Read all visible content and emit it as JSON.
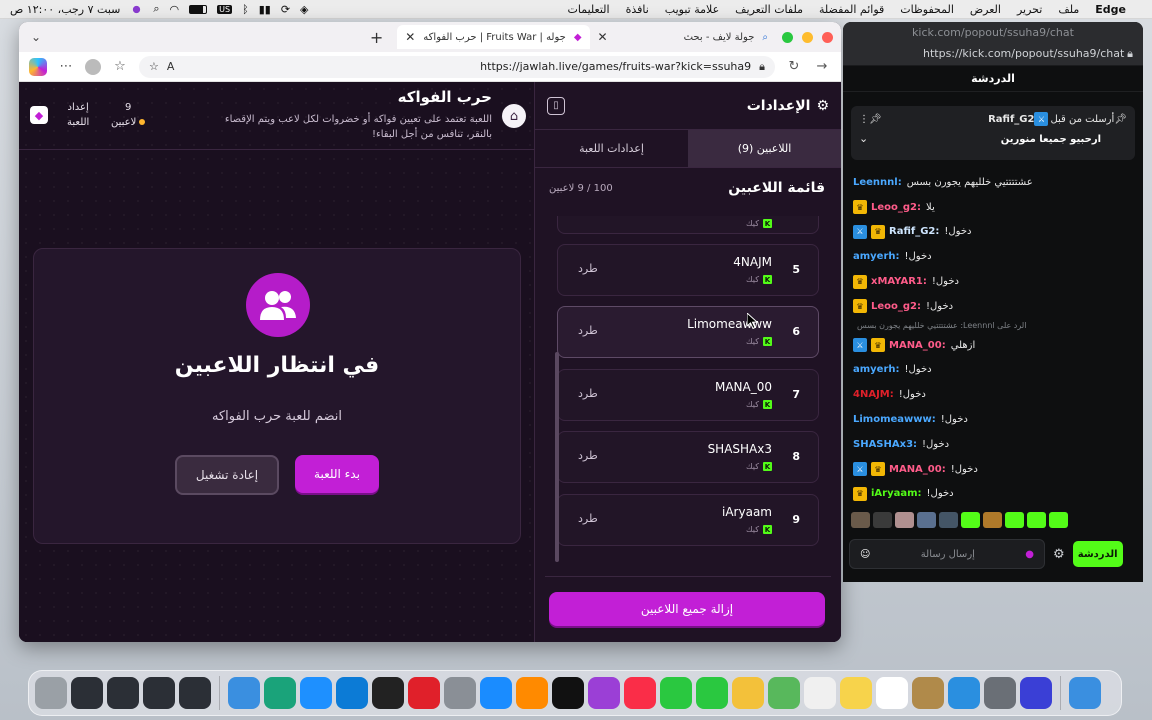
{
  "menubar": {
    "clock": "سبت ٧ رجب، ١٢:٠٠ ص",
    "input_badge": "US",
    "app_name": "Edge",
    "menus": [
      "ملف",
      "تحرير",
      "العرض",
      "المحفوظات",
      "قوائم المفضلة",
      "ملفات التعريف",
      "علامة تبويب",
      "نافذة",
      "التعليمات"
    ]
  },
  "browser": {
    "tabs": [
      {
        "label": "جولة لايف - بحث",
        "active": false
      },
      {
        "label": "حرب الفواكه | Fruits War | جوله",
        "active": true
      }
    ],
    "url": "https://jawlah.live/games/fruits-war?kick=ssuha9"
  },
  "game": {
    "title": "حرب الفواكه",
    "description": "اللعبة تعتمد على تعيين فواكه أو خضروات لكل لاعب ويتم الإقصاء بالنقر، تنافس من أجل البقاء!",
    "players_count": "9",
    "players_label": "لاعبين",
    "settings_label_1": "إعداد",
    "settings_label_2": "اللعبة",
    "waiting_title": "في انتظار اللاعبين",
    "waiting_sub": "انضم للعبة حرب الفواكه",
    "start_button": "بدء اللعبة",
    "restart_button": "إعادة تشغيل"
  },
  "settings": {
    "title": "الإعدادات",
    "tabs": [
      {
        "label": "اللاعبين (9)",
        "active": true
      },
      {
        "label": "إعدادات اللعبة",
        "active": false
      }
    ],
    "list_title": "قائمة اللاعبين",
    "count": "100 / 9 لاعبين",
    "kick_label": "طرد",
    "source_label": "كيك",
    "players": [
      {
        "num": "",
        "name": ""
      },
      {
        "num": "5",
        "name": "4NAJM"
      },
      {
        "num": "6",
        "name": "Limomeawww"
      },
      {
        "num": "7",
        "name": "MANA_00"
      },
      {
        "num": "8",
        "name": "SHASHAx3"
      },
      {
        "num": "9",
        "name": "iAryaam"
      }
    ],
    "remove_all_button": "إزالة جميع اللاعبين"
  },
  "chat": {
    "window_title": "kick.com/popout/ssuha9/chat",
    "url": "https://kick.com/popout/ssuha9/chat",
    "header": "الدردشة",
    "pinned_by": "Rafif_G2",
    "pinned_label": "أرسلت من قبل",
    "pinned_message": "ارحبيو جميعا منورين",
    "messages": [
      {
        "user": "Leennnl:",
        "text": "عشتتتتيي خلليهم يجورن بسس",
        "color": "#4aa8ff",
        "badges": []
      },
      {
        "user": "Leoo_g2:",
        "text": "يلا",
        "color": "#ff5c8a",
        "badges": [
          "crown"
        ]
      },
      {
        "user": "Rafif_G2:",
        "text": "دخول!",
        "color": "#cfe6ff",
        "badges": [
          "mod",
          "crown"
        ]
      },
      {
        "user": "amyerh:",
        "text": "دخول!",
        "color": "#4aa8ff",
        "badges": []
      },
      {
        "user": "xMAYAR1:",
        "text": "دخول!",
        "color": "#ff5c8a",
        "badges": [
          "crown"
        ]
      },
      {
        "user": "Leoo_g2:",
        "text": "دخول!",
        "color": "#ff5c8a",
        "badges": [
          "crown"
        ]
      },
      {
        "reply": "الرد على Leennnl: عشتتتتيي خلليهم يجورن بسس"
      },
      {
        "user": "MANA_00:",
        "text": "ازهلي",
        "color": "#ff5c8a",
        "badges": [
          "mod",
          "crown"
        ]
      },
      {
        "user": "amyerh:",
        "text": "دخول!",
        "color": "#4aa8ff",
        "badges": []
      },
      {
        "user": "4NAJM:",
        "text": "دخول!",
        "color": "#e0202a",
        "badges": []
      },
      {
        "user": "Limomeawww:",
        "text": "دخول!",
        "color": "#4aa8ff",
        "badges": []
      },
      {
        "user": "SHASHAx3:",
        "text": "دخول!",
        "color": "#4aa8ff",
        "badges": []
      },
      {
        "user": "MANA_00:",
        "text": "دخول!",
        "color": "#ff5c8a",
        "badges": [
          "mod",
          "crown"
        ]
      },
      {
        "user": "iAryaam:",
        "text": "دخول!",
        "color": "#53fc18",
        "badges": [
          "crown"
        ]
      }
    ],
    "input_placeholder": "إرسال رسالة",
    "send_button": "الدردشة"
  },
  "dock": {
    "apps": [
      "trash-icon",
      "window-thumb",
      "window-thumb",
      "window-thumb",
      "window-thumb",
      "finder",
      "copilot",
      "safari",
      "edge",
      "obs",
      "opera",
      "system-settings",
      "app-store",
      "books",
      "apple-tv",
      "podcasts",
      "music",
      "facetime",
      "messages",
      "photos",
      "maps",
      "reminders",
      "notes",
      "calendar",
      "scanner",
      "mail",
      "launchpad",
      "siri",
      "finder-face"
    ]
  }
}
